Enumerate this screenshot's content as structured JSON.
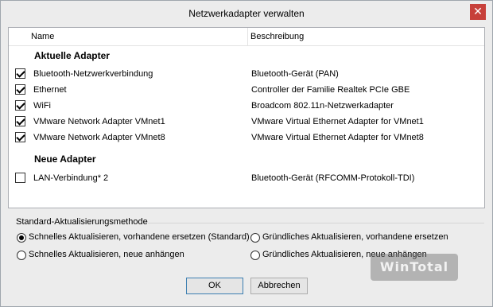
{
  "window": {
    "title": "Netzwerkadapter verwalten",
    "close_symbol": "✕"
  },
  "list": {
    "columns": [
      "Name",
      "Beschreibung"
    ],
    "groups": [
      {
        "label": "Aktuelle Adapter"
      },
      {
        "label": "Neue Adapter"
      }
    ],
    "current_adapters": [
      {
        "checked": true,
        "name": "Bluetooth-Netzwerkverbindung",
        "description": "Bluetooth-Gerät (PAN)"
      },
      {
        "checked": true,
        "name": "Ethernet",
        "description": "Controller der Familie Realtek PCIe GBE"
      },
      {
        "checked": true,
        "name": "WiFi",
        "description": "Broadcom 802.11n-Netzwerkadapter"
      },
      {
        "checked": true,
        "name": "VMware Network Adapter VMnet1",
        "description": "VMware Virtual Ethernet Adapter for VMnet1"
      },
      {
        "checked": true,
        "name": "VMware Network Adapter VMnet8",
        "description": "VMware Virtual Ethernet Adapter for VMnet8"
      }
    ],
    "new_adapters": [
      {
        "checked": false,
        "name": "LAN-Verbindung* 2",
        "description": "Bluetooth-Gerät (RFCOMM-Protokoll-TDI)"
      }
    ]
  },
  "update_method": {
    "label": "Standard-Aktualisierungsmethode",
    "options": [
      {
        "label": "Schnelles Aktualisieren, vorhandene ersetzen (Standard)",
        "selected": true
      },
      {
        "label": "Gründliches Aktualisieren, vorhandene ersetzen",
        "selected": false
      },
      {
        "label": "Schnelles Aktualisieren, neue anhängen",
        "selected": false
      },
      {
        "label": "Gründliches Aktualisieren, neue anhängen",
        "selected": false
      }
    ]
  },
  "buttons": {
    "ok": "OK",
    "cancel": "Abbrechen"
  },
  "watermark": "WinTotal",
  "colors": {
    "close_button": "#c7403a",
    "default_button_border": "#3c7fb1"
  }
}
